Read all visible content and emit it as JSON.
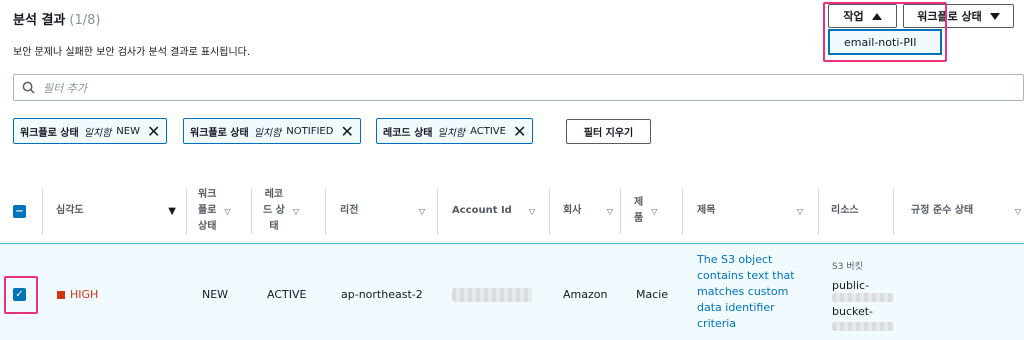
{
  "header": {
    "title": "분석 결과",
    "count": "(1/8)",
    "description": "보안 문제나 실패한 보안 검사가 분석 결과로 표시됩니다."
  },
  "toolbar": {
    "actions_label": "작업",
    "workflow_label": "워크플로 상태"
  },
  "actions_menu": {
    "items": [
      "email-noti-PII"
    ]
  },
  "search": {
    "placeholder": "필터 추가",
    "value": ""
  },
  "filters": [
    {
      "field": "워크플로 상태",
      "op": "일치함",
      "value": "NEW"
    },
    {
      "field": "워크플로 상태",
      "op": "일치함",
      "value": "NOTIFIED"
    },
    {
      "field": "레코드 상태",
      "op": "일치함",
      "value": "ACTIVE"
    }
  ],
  "clear_filters_label": "필터 지우기",
  "table": {
    "columns": [
      "심각도",
      "워크\n플로\n상태",
      "레코\n드 상\n태",
      "리전",
      "Account Id",
      "회사",
      "제\n품",
      "제목",
      "리소스",
      "규정 준수 상태"
    ],
    "rows": [
      {
        "selected": true,
        "severity": "HIGH",
        "workflow": "NEW",
        "record": "ACTIVE",
        "region": "ap-northeast-2",
        "company": "Amazon",
        "product": "Macie",
        "title": "The S3 object contains text that matches custom data identifier criteria",
        "resource_type": "S3 버킷",
        "resource_name_1": "public-",
        "resource_name_2": "bucket-"
      }
    ]
  },
  "colors": {
    "accent": "#0073bb",
    "highlight": "#e8327f",
    "severity_high": "#d13212",
    "row_bg": "#f1faff"
  }
}
